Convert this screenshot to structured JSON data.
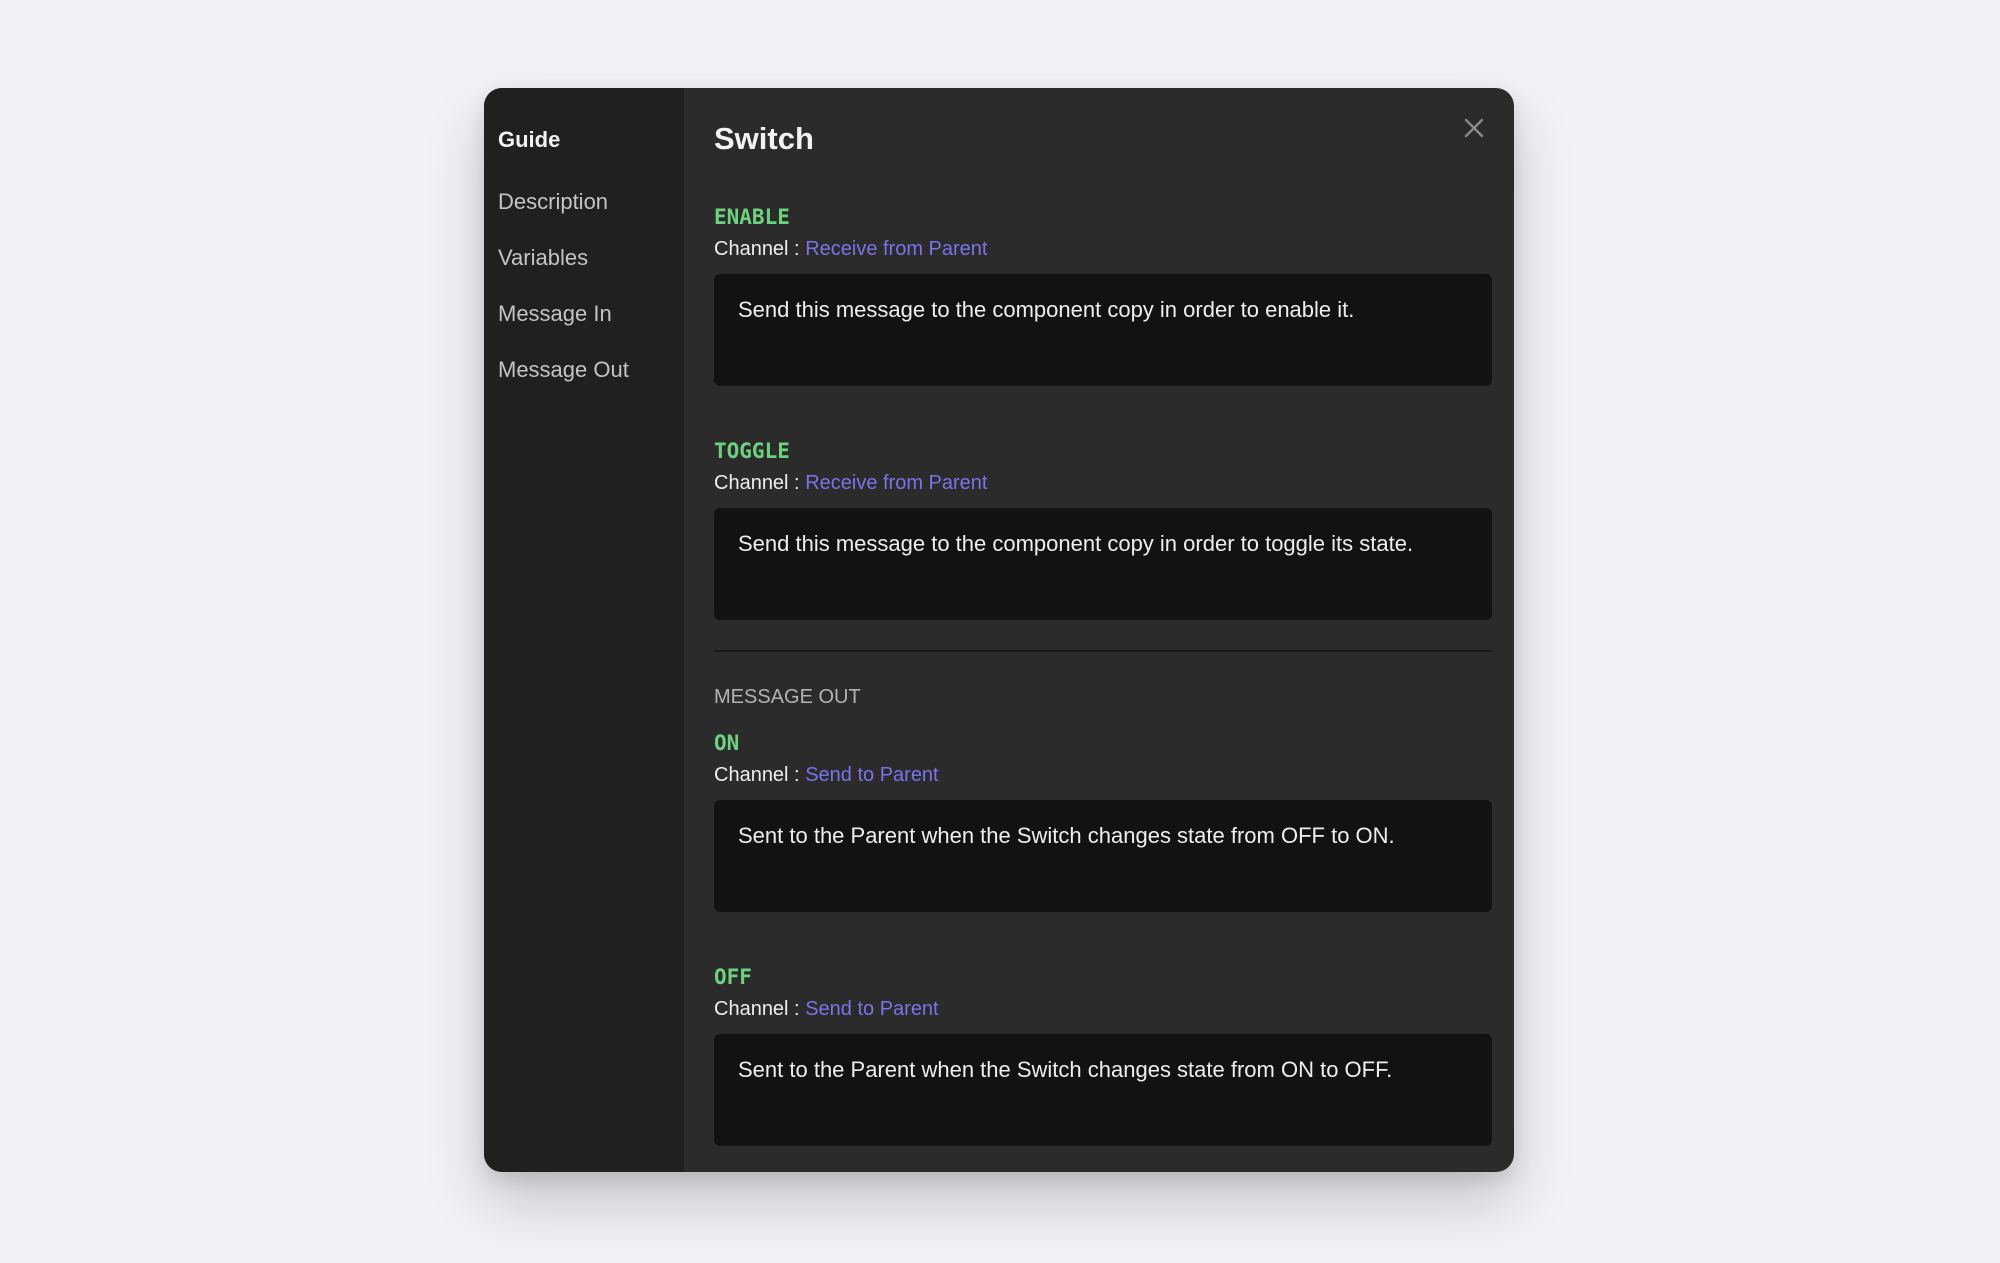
{
  "sidebar": {
    "title": "Guide",
    "items": [
      {
        "label": "Description"
      },
      {
        "label": "Variables"
      },
      {
        "label": "Message In"
      },
      {
        "label": "Message Out"
      }
    ]
  },
  "main": {
    "title": "Switch",
    "close_icon": "close-icon",
    "channel_label": "Channel :",
    "message_in": [
      {
        "name": "ENABLE",
        "channel": "Receive from Parent",
        "description": "Send this message to the component copy in order to enable it."
      },
      {
        "name": "TOGGLE",
        "channel": "Receive from Parent",
        "description": "Send this message to the component copy in order to toggle its state."
      }
    ],
    "message_out_title": "MESSAGE OUT",
    "message_out": [
      {
        "name": "ON",
        "channel": "Send to Parent",
        "description": "Sent to the Parent when the Switch changes state from OFF to ON."
      },
      {
        "name": "OFF",
        "channel": "Send to Parent",
        "description": "Sent to the Parent when the Switch changes state from ON to OFF."
      }
    ]
  },
  "colors": {
    "message_name": "#6dd17e",
    "channel_link": "#7b73e8",
    "sidebar_bg": "#202020",
    "main_bg": "#2b2b2b",
    "desc_bg": "#121212",
    "page_bg": "#f1f2f6"
  }
}
